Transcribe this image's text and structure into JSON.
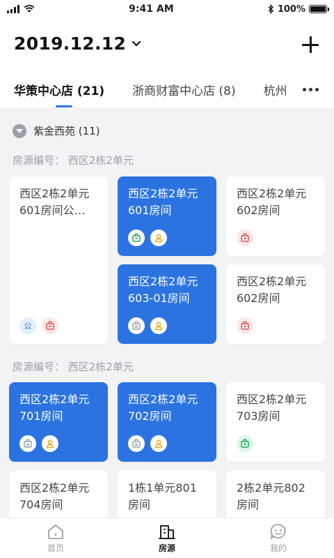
{
  "status_bar": {
    "time": "9:41 AM",
    "battery": "100%"
  },
  "header": {
    "date": "2019.12.12",
    "tabs": [
      {
        "label": "华策中心店 (21)"
      },
      {
        "label": "浙商财富中心店 (8)"
      },
      {
        "label": "杭州"
      }
    ]
  },
  "group": {
    "title": "紫金西苑 (11)"
  },
  "sections": [
    {
      "label": "房源编号：  西区2栋2单元"
    },
    {
      "label": "房源编号：  西区2栋2单元"
    }
  ],
  "cards": [
    {
      "line1": "西区2栋2单元",
      "line2": "601房间公…",
      "highlight": false,
      "badges": [
        "公",
        "lock-red"
      ]
    },
    {
      "line1": "西区2栋2单元",
      "line2": "601房间",
      "highlight": true,
      "badges": [
        "lock-green",
        "user-yellow"
      ]
    },
    {
      "line1": "西区2栋2单元",
      "line2": "602房间",
      "highlight": false,
      "badges": [
        "lock-red"
      ]
    },
    {
      "line1": "西区2栋2单元",
      "line2": "603-01房间",
      "highlight": true,
      "badges": [
        "lock-white",
        "user-yellow"
      ]
    },
    {
      "line1": "西区2栋2单元",
      "line2": "602房间",
      "highlight": false,
      "badges": [
        "lock-red"
      ]
    },
    {
      "line1": "西区2栋2单元",
      "line2": "701房间",
      "highlight": true,
      "badges": [
        "lock-white",
        "user-yellow"
      ]
    },
    {
      "line1": "西区2栋2单元",
      "line2": "702房间",
      "highlight": true,
      "badges": [
        "lock-white",
        "user-yellow"
      ]
    },
    {
      "line1": "西区2栋2单元",
      "line2": "703房间",
      "highlight": false,
      "badges": [
        "lock-green"
      ]
    },
    {
      "line1": "西区2栋2单元",
      "line2": "704房间",
      "highlight": false,
      "badges": []
    },
    {
      "line1": "1栋1单元801",
      "line2": "房间",
      "highlight": false,
      "badges": []
    },
    {
      "line1": "2栋2单元802",
      "line2": "房间",
      "highlight": false,
      "badges": []
    }
  ],
  "tabbar": [
    {
      "label": "首页",
      "icon": "home-icon"
    },
    {
      "label": "房源",
      "icon": "building-icon"
    },
    {
      "label": "我的",
      "icon": "chat-face-icon"
    }
  ],
  "colors": {
    "accent": "#2a73e0",
    "lock_red": "#e25555",
    "lock_green": "#23a661",
    "user_yellow": "#e9a81c",
    "muted": "#9aa0a8"
  }
}
